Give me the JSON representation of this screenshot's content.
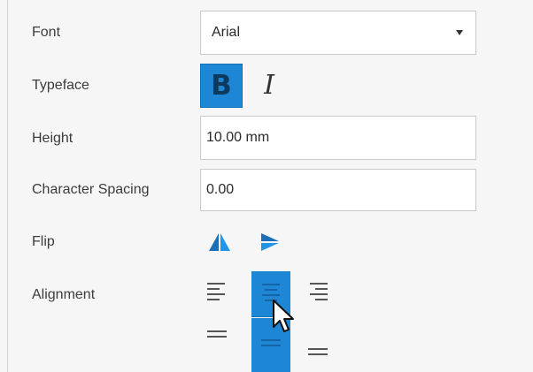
{
  "labels": {
    "font": "Font",
    "typeface": "Typeface",
    "height": "Height",
    "character_spacing": "Character Spacing",
    "flip": "Flip",
    "alignment": "Alignment"
  },
  "font": {
    "selected": "Arial"
  },
  "typeface": {
    "bold_glyph": "B",
    "italic_glyph": "I",
    "bold_selected": true,
    "italic_selected": false
  },
  "height": {
    "value": "10.00 mm"
  },
  "character_spacing": {
    "value": "0.00"
  },
  "flip": {
    "icons": [
      "flip-horizontal-icon",
      "flip-vertical-icon"
    ]
  },
  "alignment": {
    "horizontal": [
      "align-left-icon",
      "align-center-icon",
      "align-right-icon"
    ],
    "vertical": [
      "align-top-icon",
      "align-middle-icon",
      "align-bottom-icon"
    ],
    "selected_horizontal": "center",
    "selected_vertical": "middle"
  },
  "colors": {
    "accent": "#1d87d6",
    "flip_icon": "#2196e8",
    "background": "#f6f6f6"
  }
}
